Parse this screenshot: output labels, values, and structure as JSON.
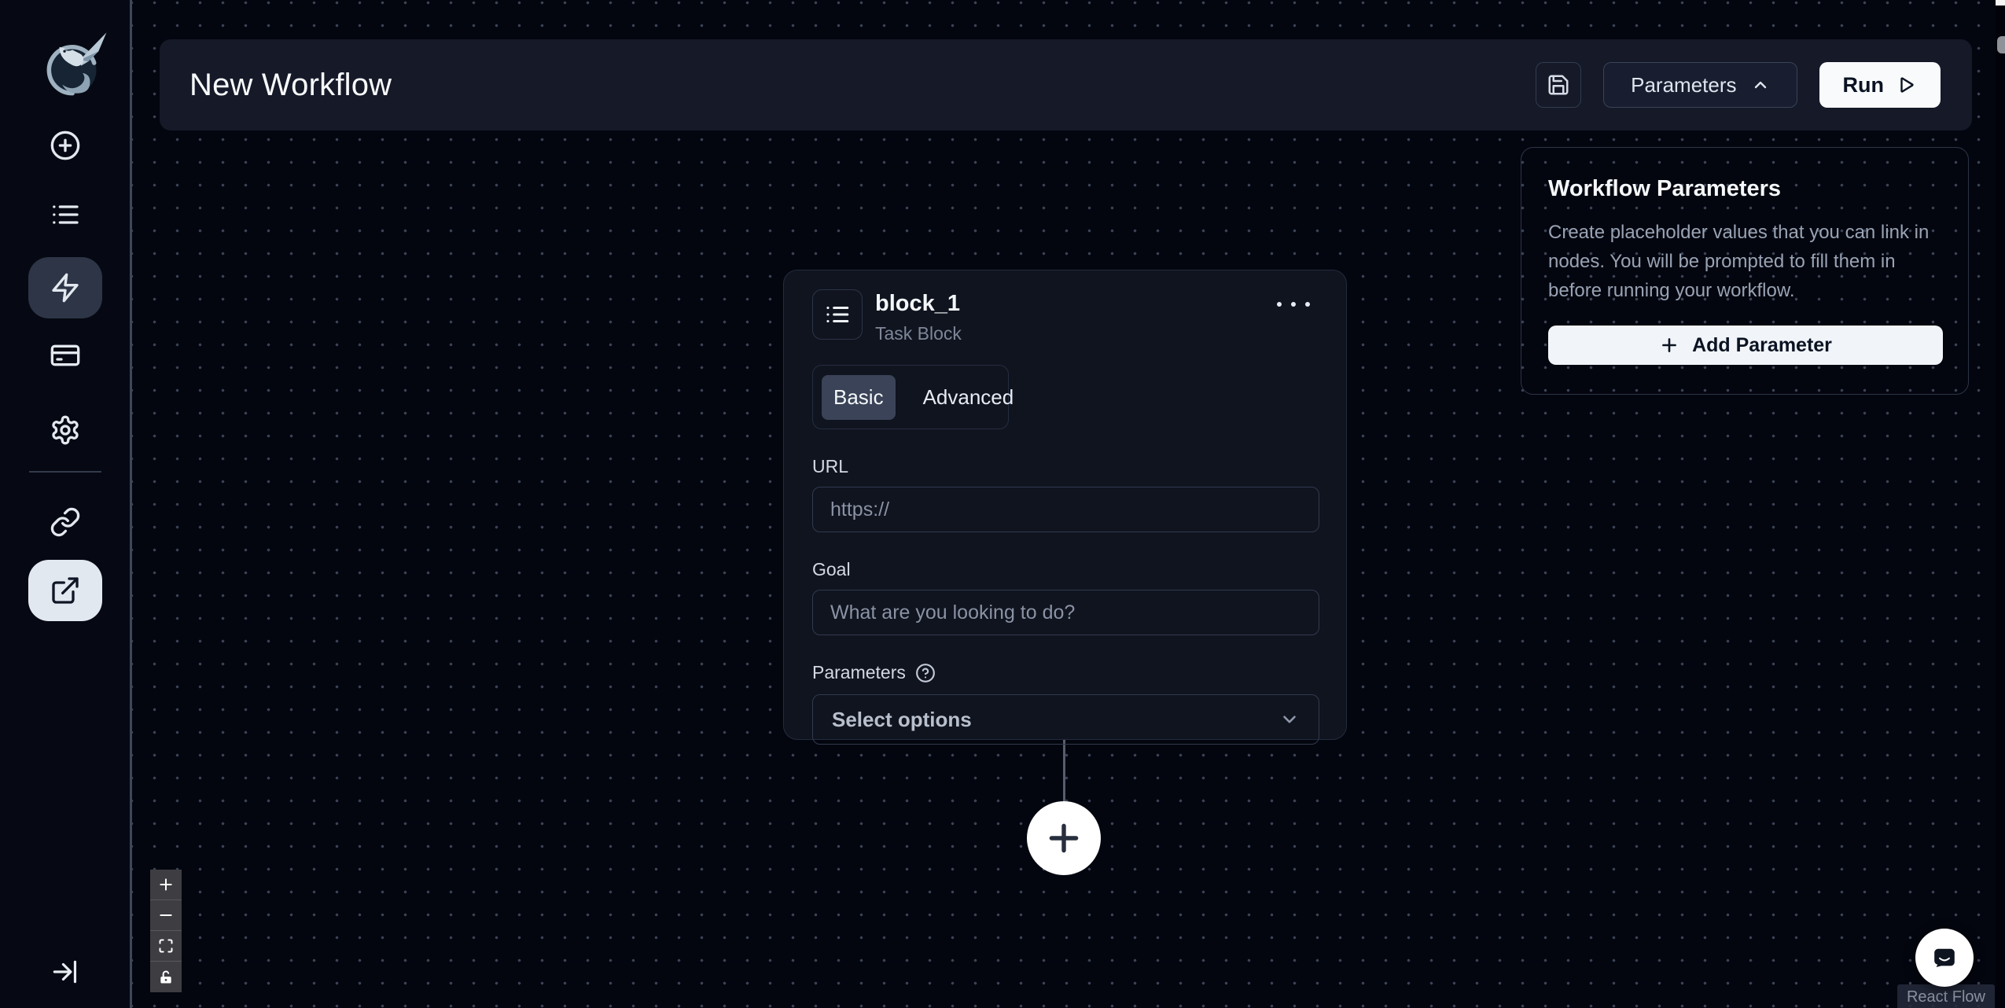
{
  "app": {
    "logo_icon": "skyvern-dragon-logo"
  },
  "sidebar": {
    "icons": [
      {
        "name": "create-icon",
        "active": false
      },
      {
        "name": "runs-list-icon",
        "active": false
      },
      {
        "name": "workflows-zap-icon",
        "active": true,
        "active_style": "dark-pill"
      },
      {
        "name": "credentials-card-icon",
        "active": false
      },
      {
        "name": "settings-gear-icon",
        "active": false
      },
      {
        "name": "link-icon",
        "active": false
      },
      {
        "name": "external-link-icon",
        "active": true,
        "active_style": "light-pill"
      },
      {
        "name": "expand-sidebar-icon",
        "active": false
      }
    ]
  },
  "header": {
    "title": "New Workflow",
    "save_icon": "floppy-disk-icon",
    "parameters_button": {
      "label": "Parameters",
      "icon": "chevron-up-icon"
    },
    "run_button": {
      "label": "Run",
      "icon": "play-icon"
    }
  },
  "workflow_parameters_panel": {
    "title": "Workflow Parameters",
    "description": "Create placeholder values that you can link in nodes. You will be prompted to fill them in before running your workflow.",
    "add_button_label": "Add Parameter"
  },
  "node": {
    "name": "block_1",
    "type_label": "Task Block",
    "icon": "list-icon",
    "menu_icon": "more-horizontal-icon",
    "tabs": [
      {
        "label": "Basic",
        "active": true
      },
      {
        "label": "Advanced",
        "active": false
      }
    ],
    "url_field": {
      "label": "URL",
      "value": "",
      "placeholder": "https://"
    },
    "goal_field": {
      "label": "Goal",
      "value": "",
      "placeholder": "What are you looking to do?"
    },
    "parameters_field": {
      "label": "Parameters",
      "help_icon": "help-circle-icon",
      "placeholder": "Select options"
    }
  },
  "canvas": {
    "add_node_button": "plus-circle-node",
    "controls": [
      {
        "name": "zoom-in",
        "icon": "plus-icon"
      },
      {
        "name": "zoom-out",
        "icon": "minus-icon"
      },
      {
        "name": "fit-view",
        "icon": "fit-view-icon"
      },
      {
        "name": "toggle-interactivity",
        "icon": "unlock-icon"
      }
    ]
  },
  "misc": {
    "chat_launcher_icon": "chat-bubble-icon",
    "attribution": "React Flow"
  },
  "colors": {
    "canvas_bg": "#04060f",
    "sidebar_bg": "#060913",
    "header_bg": "#151928",
    "card_bg": "#10141f",
    "accent_light": "#f8fafc",
    "active_pill_dark": "#2d3546",
    "active_pill_light": "#e2e8f0",
    "muted_text": "#99a3b4",
    "border": "#323a4f"
  }
}
